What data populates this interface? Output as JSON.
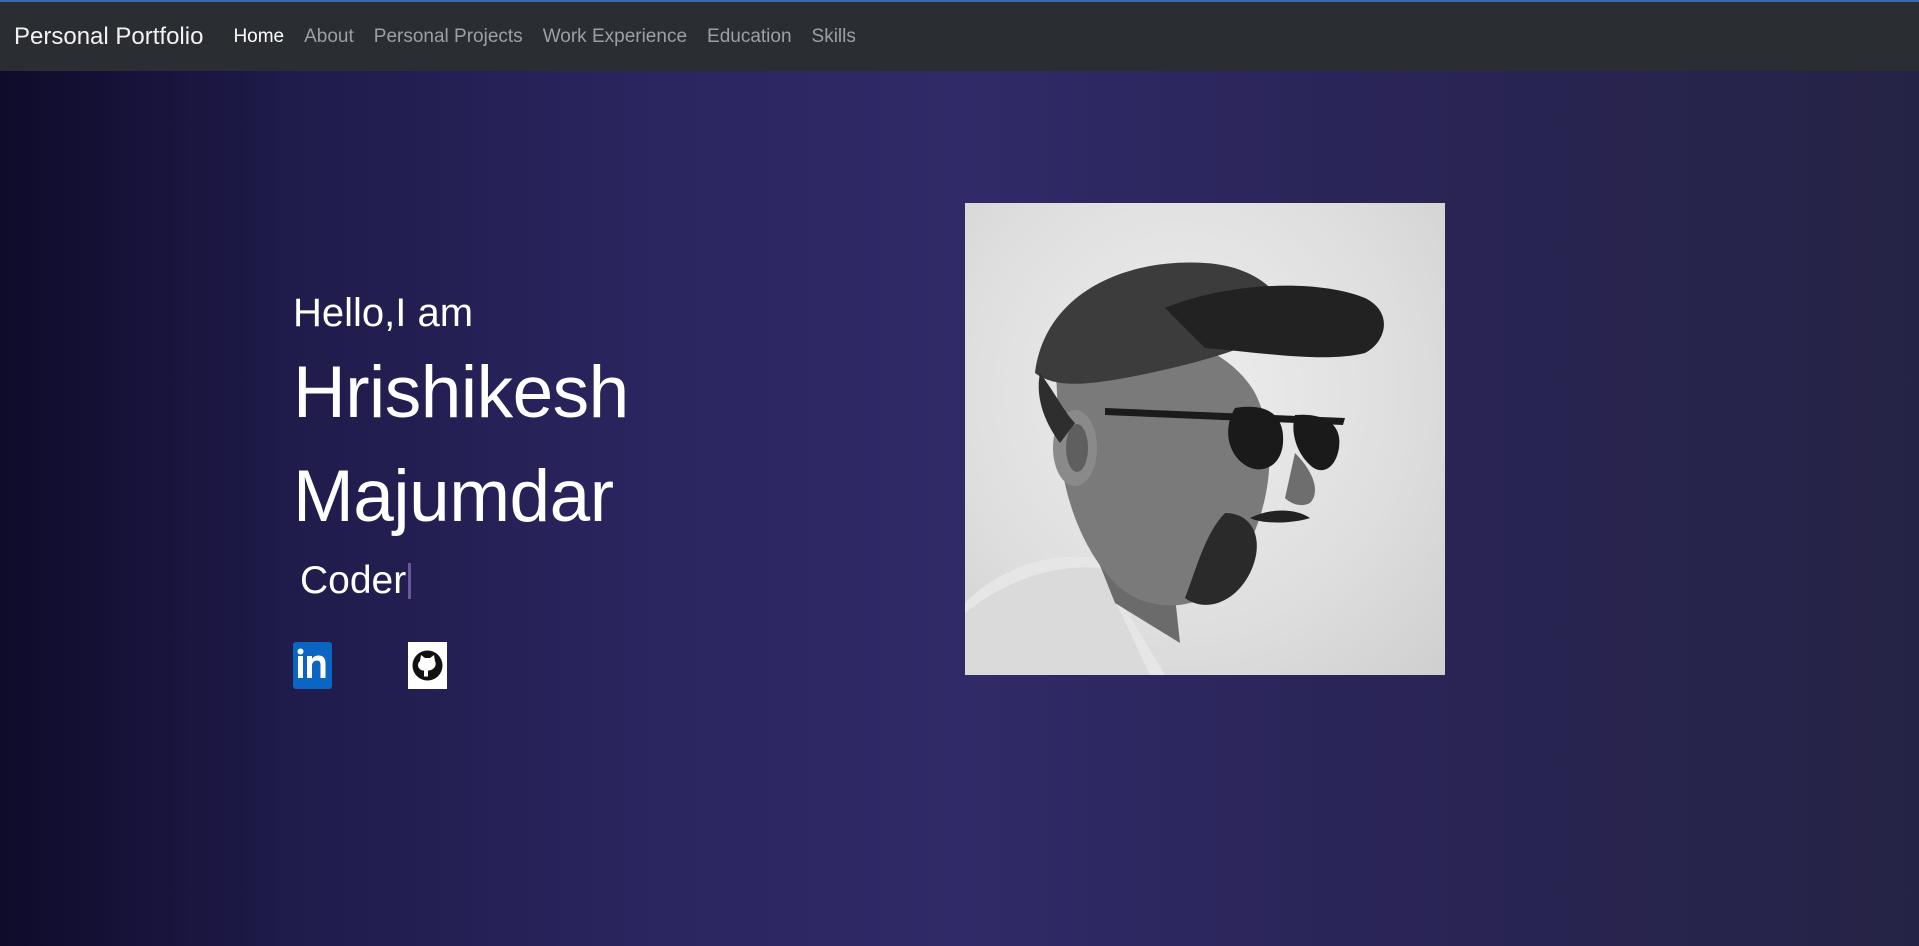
{
  "nav": {
    "brand": "Personal Portfolio",
    "links": [
      {
        "label": "Home",
        "active": true
      },
      {
        "label": "About"
      },
      {
        "label": "Personal Projects"
      },
      {
        "label": "Work Experience"
      },
      {
        "label": "Education"
      },
      {
        "label": "Skills"
      }
    ]
  },
  "hero": {
    "greeting": "Hello,I am",
    "first_name": "Hrishikesh",
    "last_name": "Majumdar",
    "role": "Coder"
  },
  "socials": {
    "linkedin_icon": "linkedin-icon",
    "github_icon": "github-icon"
  },
  "photo": {
    "icon": "profile-photo"
  },
  "colors": {
    "navbar_bg": "#2a2e33",
    "accent_top": "#3b6aa8",
    "linkedin": "#0a66c2",
    "background_mid": "#302a68"
  }
}
